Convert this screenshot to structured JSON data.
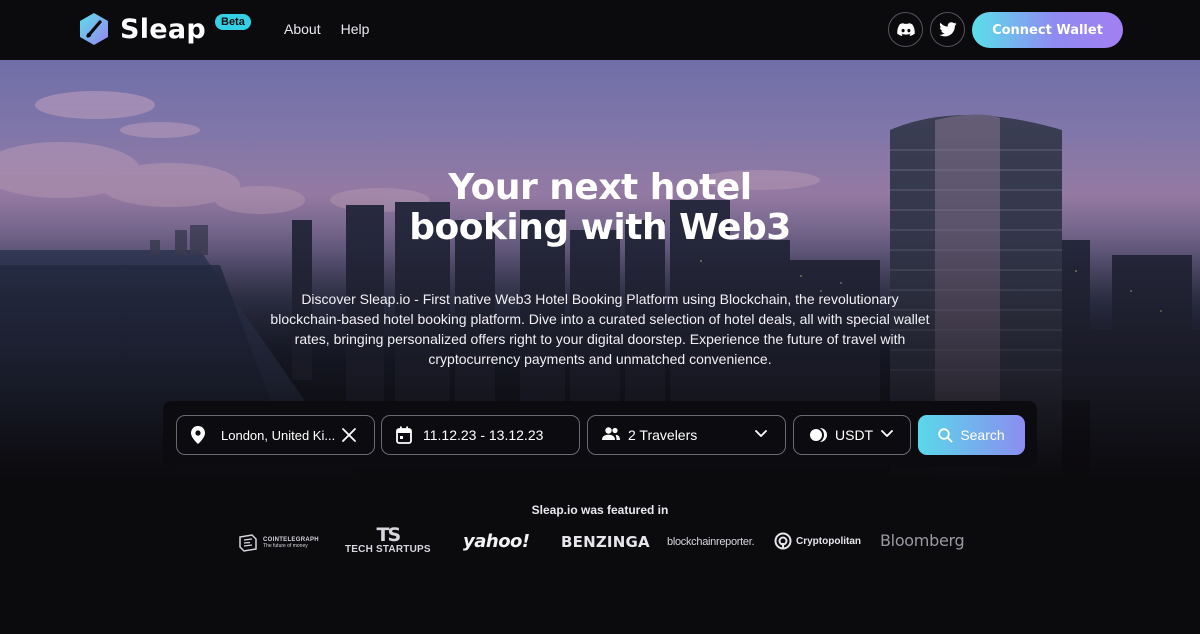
{
  "header": {
    "brand": "Sleap",
    "beta_badge": "Beta",
    "nav": {
      "about": "About",
      "help": "Help"
    },
    "social": {
      "discord_icon": "discord-icon",
      "twitter_icon": "twitter-icon"
    },
    "connect_wallet": "Connect Wallet"
  },
  "hero": {
    "title_line1": "Your next hotel",
    "title_line2": "booking with Web3",
    "description": "Discover Sleap.io - First native Web3 Hotel Booking Platform using Blockchain, the revolutionary blockchain-based hotel booking platform. Dive into a curated selection of hotel deals, all with special wallet rates, bringing personalized offers right to your digital doorstep. Experience the future of travel with cryptocurrency payments and unmatched convenience."
  },
  "search": {
    "location_value": "London, United Ki...",
    "dates_value": "11.12.23 - 13.12.23",
    "travelers_value": "2 Travelers",
    "currency_value": "USDT",
    "search_label": "Search"
  },
  "featured": {
    "title": "Sleap.io was featured in",
    "logos": {
      "cointelegraph": "COINTELEGRAPH",
      "cointelegraph_tagline": "The future of money",
      "techstartups_mark": "TS",
      "techstartups": "TECH STARTUPS",
      "yahoo": "yahoo!",
      "benzinga": "BENZINGA",
      "blockchainreporter": "blockchainreporter.",
      "cryptopolitan": "Cryptopolitan",
      "bloomberg": "Bloomberg"
    }
  },
  "colors": {
    "accent_start": "#5ae0ea",
    "accent_end": "#a37ff2",
    "background": "#0b0a0d"
  }
}
